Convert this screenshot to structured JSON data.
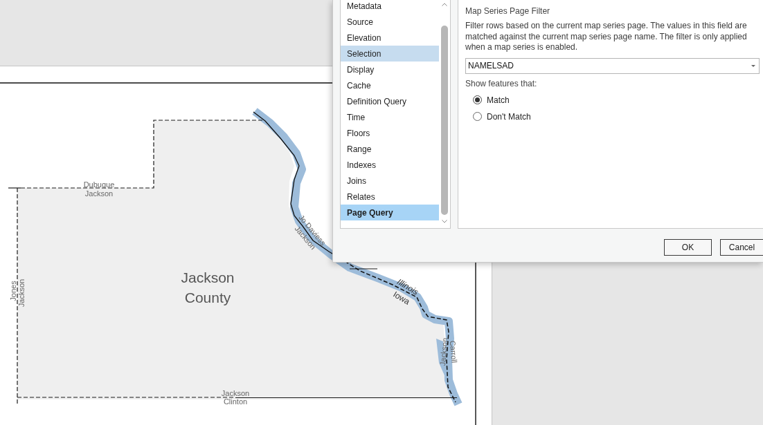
{
  "map": {
    "county_name": "Jackson County",
    "boundary_labels": [
      "Dubuque",
      "Jackson",
      "Jones",
      "Jackson",
      "Jo Daviess",
      "Jackson",
      "Jackson",
      "Carroll",
      "Jackson",
      "Clinton"
    ],
    "state_labels": [
      "Illinois",
      "Iowa"
    ]
  },
  "dialog": {
    "pages": [
      {
        "label": "Metadata",
        "selected": false,
        "hovered": false
      },
      {
        "label": "Source",
        "selected": false,
        "hovered": false
      },
      {
        "label": "Elevation",
        "selected": false,
        "hovered": false
      },
      {
        "label": "Selection",
        "selected": false,
        "hovered": true
      },
      {
        "label": "Display",
        "selected": false,
        "hovered": false
      },
      {
        "label": "Cache",
        "selected": false,
        "hovered": false
      },
      {
        "label": "Definition Query",
        "selected": false,
        "hovered": false
      },
      {
        "label": "Time",
        "selected": false,
        "hovered": false
      },
      {
        "label": "Floors",
        "selected": false,
        "hovered": false
      },
      {
        "label": "Range",
        "selected": false,
        "hovered": false
      },
      {
        "label": "Indexes",
        "selected": false,
        "hovered": false
      },
      {
        "label": "Joins",
        "selected": false,
        "hovered": false
      },
      {
        "label": "Relates",
        "selected": false,
        "hovered": false
      },
      {
        "label": "Page Query",
        "selected": true,
        "hovered": false
      }
    ],
    "section_title": "Map Series Page Filter",
    "description": "Filter rows based on the current map series page. The values in this field are matched against the current map series page name. The filter is only applied when a map series is enabled.",
    "field": {
      "value": "NAMELSAD"
    },
    "show_label": "Show features that:",
    "options": [
      {
        "label": "Match",
        "selected": true
      },
      {
        "label": "Don't Match",
        "selected": false
      }
    ],
    "buttons": [
      "OK",
      "Cancel"
    ]
  }
}
